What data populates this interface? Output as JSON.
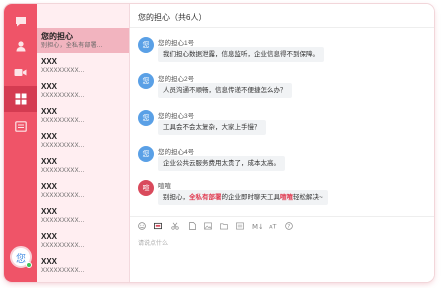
{
  "rail": {
    "avatar_text": "您",
    "icons": [
      "chat-icon",
      "contacts-icon",
      "video-icon",
      "apps-icon",
      "notes-icon"
    ],
    "colors": {
      "rail": "#ef5468",
      "active": "#d43b51",
      "online": "#3cc257"
    }
  },
  "list": {
    "items": [
      {
        "name": "您的担心",
        "sub": "别担心，全私有部署..."
      },
      {
        "name": "XXX",
        "sub": "XXXXXXXXX..."
      },
      {
        "name": "XXX",
        "sub": "XXXXXXXXX..."
      },
      {
        "name": "XXX",
        "sub": "XXXXXXXXX..."
      },
      {
        "name": "XXX",
        "sub": "XXXXXXXXX..."
      },
      {
        "name": "XXX",
        "sub": "XXXXXXXXX..."
      },
      {
        "name": "XXX",
        "sub": "XXXXXXXXX..."
      },
      {
        "name": "XXX",
        "sub": "XXXXXXXXX..."
      },
      {
        "name": "XXX",
        "sub": "XXXXXXXXX..."
      },
      {
        "name": "XXX",
        "sub": "XXXXXXXXX..."
      }
    ]
  },
  "chat": {
    "title": "您的担心（共6人）",
    "messages": [
      {
        "avatar": "您",
        "sender": "您的担心1号",
        "text": "我们担心数据泄露，信息监听，企业信息得不到保障。"
      },
      {
        "avatar": "您",
        "sender": "您的担心2号",
        "text": "人员沟通不顺畅，信息传递不便捷怎么办？"
      },
      {
        "avatar": "您",
        "sender": "您的担心3号",
        "text": "工具会不会太复杂，大家上手慢？"
      },
      {
        "avatar": "您",
        "sender": "您的担心4号",
        "text": "企业公共云服务费用太贵了，成本太高。"
      },
      {
        "avatar": "喧",
        "sender": "喧喧",
        "text_pre": "别担心，",
        "text_hl1": "全私有部署",
        "text_mid": "的企业即时聊天工具",
        "text_hl2": "喧喧",
        "text_post": "轻松解决~"
      }
    ],
    "input_placeholder": "请说点什么"
  },
  "toolbar": {
    "icons": [
      "emoji-icon",
      "screenshot-icon",
      "scissors-icon",
      "file-icon",
      "image-icon",
      "folder-icon",
      "code-icon",
      "markdown-icon",
      "font-icon",
      "help-icon"
    ]
  }
}
